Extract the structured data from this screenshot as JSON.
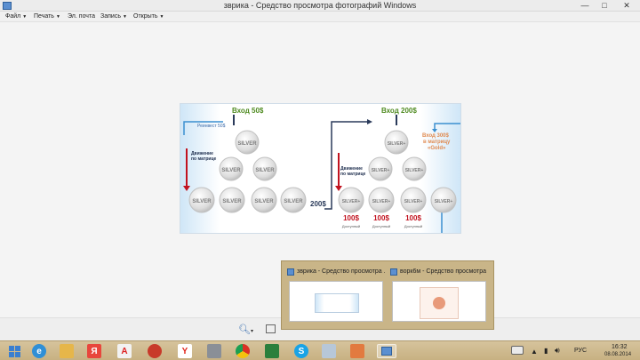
{
  "window": {
    "title": "зврика - Средство просмотра фотографий Windows",
    "minimize": "—",
    "maximize": "□",
    "close": "✕"
  },
  "menu": [
    {
      "label": "Файл"
    },
    {
      "label": "Печать"
    },
    {
      "label": "Эл. почта"
    },
    {
      "label": "Запись"
    },
    {
      "label": "Открыть"
    }
  ],
  "diagram": {
    "entry_left": "Вход 50$",
    "entry_right": "Вход 200$",
    "reinvest": "Реинвест 50$",
    "move_left_1": "Движение",
    "move_left_2": "по матрице",
    "move_right_1": "Движение",
    "move_right_2": "по матрице",
    "transfer": "200$",
    "gold_1": "Вход 300$",
    "gold_2": "в матрицу",
    "gold_3": "«Gold»",
    "coin_silver": "SILVER",
    "coin_silver_plus": "SILVER+",
    "payout": "100$",
    "available": "Доступный",
    "colors": {
      "entry_text": "#4e8a1f",
      "arrow_blue": "#3b6aa8",
      "arrow_red": "#c1121f",
      "gold_text": "#e08a50"
    }
  },
  "thumbnails": [
    {
      "title": "зврика - Средство просмотра ..."
    },
    {
      "title": "ворк6м - Средство просмотра ..."
    }
  ],
  "taskbar": {
    "apps": [
      {
        "icon": "windows-start-icon"
      },
      {
        "icon": "internet-explorer-icon",
        "glyph": "e"
      },
      {
        "icon": "file-explorer-icon"
      },
      {
        "icon": "yandex-icon",
        "glyph": "Я"
      },
      {
        "icon": "app-icon"
      },
      {
        "icon": "yandex-browser-icon",
        "glyph": "Y"
      },
      {
        "icon": "app-icon-2"
      },
      {
        "icon": "chrome-icon"
      },
      {
        "icon": "app-icon-3"
      },
      {
        "icon": "skype-icon",
        "glyph": "S"
      },
      {
        "icon": "app-icon-4"
      },
      {
        "icon": "paint-icon"
      },
      {
        "icon": "photo-viewer-icon"
      }
    ],
    "lang": "РУС",
    "time": "16:32",
    "date": "08.08.2014"
  }
}
